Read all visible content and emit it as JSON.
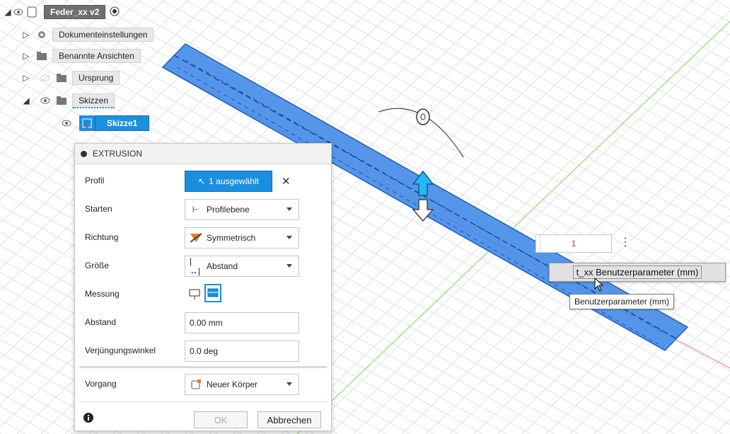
{
  "browser": {
    "document_name": "Feder_xx v2",
    "items": [
      {
        "label": "Dokumenteinstellungen"
      },
      {
        "label": "Benannte Ansichten"
      },
      {
        "label": "Ursprung"
      },
      {
        "label": "Skizzen"
      },
      {
        "label": "Skizze1"
      }
    ]
  },
  "extrusion": {
    "title": "EXTRUSION",
    "rows": {
      "profil": {
        "label": "Profil",
        "value": "1 ausgewählt"
      },
      "starten": {
        "label": "Starten",
        "value": "Profilebene"
      },
      "richtung": {
        "label": "Richtung",
        "value": "Symmetrisch"
      },
      "groesse": {
        "label": "Größe",
        "value": "Abstand"
      },
      "messung": {
        "label": "Messung"
      },
      "abstand": {
        "label": "Abstand",
        "value": "0.00 mm"
      },
      "verjuengung": {
        "label": "Verjüngungswinkel",
        "value": "0.0 deg"
      },
      "vorgang": {
        "label": "Vorgang",
        "value": "Neuer Körper"
      }
    },
    "ok_label": "OK",
    "cancel_label": "Abbrechen"
  },
  "value_input": {
    "value": "1"
  },
  "suggestion": {
    "text": "t_xx  Benutzerparameter (mm)"
  },
  "tooltip": {
    "text": "Benutzerparameter (mm)"
  },
  "colors": {
    "accent": "#1a8fe0",
    "body": "#3b82e6",
    "grid": "#d9dde3",
    "axis_green": "#7ed957",
    "axis_red": "#e05a5a"
  }
}
